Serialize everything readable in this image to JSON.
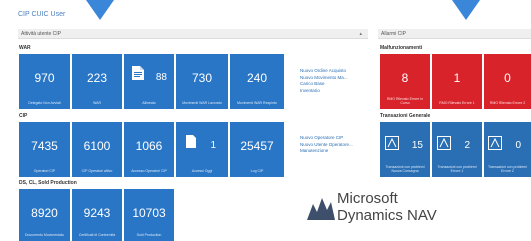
{
  "page": {
    "title": "CIP CUIC User"
  },
  "left_panel": {
    "header": "Attività utente CIP"
  },
  "right_panel": {
    "header": "Allarmi CIP"
  },
  "sections": {
    "s1_title": "WAR",
    "s1_tiles": [
      {
        "value": "970",
        "label": "Delegato Non Avviati"
      },
      {
        "value": "223",
        "label": "WAR"
      },
      {
        "value": "88",
        "label": "Allineato"
      },
      {
        "value": "730",
        "label": "Movimenti WAR Lavorato"
      },
      {
        "value": "240",
        "label": "Movimenti WAR Respinto"
      }
    ],
    "s1_links": [
      "Nuovo Ordine Acquisto",
      "Nuovo Movimento Ma...",
      "Carico Base",
      "Inventario"
    ],
    "s2_title": "CIP",
    "s2_tiles": [
      {
        "value": "7435",
        "label": "Operatori CIP"
      },
      {
        "value": "6100",
        "label": "CIP Operatori attivo"
      },
      {
        "value": "1066",
        "label": "Accesso Operatori CIP"
      },
      {
        "value": "1",
        "label": "Accessi Oggi"
      },
      {
        "value": "25457",
        "label": "Log CIP"
      }
    ],
    "s2_links": [
      "Nuovo Operatore CIP",
      "Nuovo Utente Operatore...",
      "Manutenzione"
    ],
    "s3_title": "DS, CL, Sold Production",
    "s3_tiles": [
      {
        "value": "8920",
        "label": "Documento Movimentato"
      },
      {
        "value": "9243",
        "label": "Certificati di Conformità"
      },
      {
        "value": "10703",
        "label": "Sold Production"
      }
    ],
    "r1_title": "Malfunzionamenti",
    "r1_tiles": [
      {
        "value": "8",
        "label": "RMO Rilevato Errore In Corso"
      },
      {
        "value": "1",
        "label": "RMO Rilevato Errore 1"
      },
      {
        "value": "0",
        "label": "RMO Rilevato Errore 2"
      }
    ],
    "r2_title": "Transazioni Generale",
    "r2_tiles": [
      {
        "value": "15",
        "label": "Transazioni con problemi Nuova Consegna"
      },
      {
        "value": "2",
        "label": "Transazioni con problemi Errore 1"
      },
      {
        "value": "0",
        "label": "Transazioni con problemi Errore 2"
      }
    ]
  },
  "logo": {
    "line1": "Microsoft",
    "line2": "Dynamics NAV"
  },
  "colors": {
    "tile_blue": "#2a76c6",
    "tile_red": "#d8232a",
    "arrow_blue": "#3a86d9"
  }
}
